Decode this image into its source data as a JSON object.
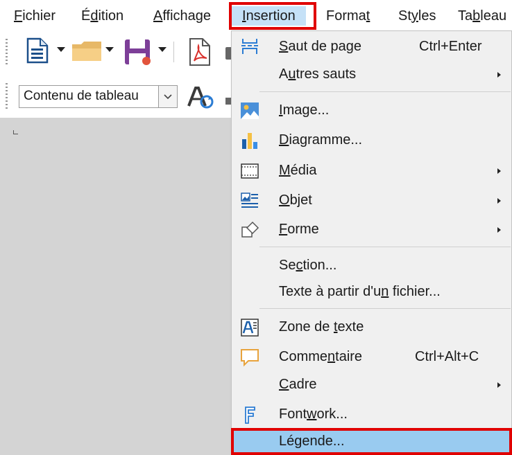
{
  "menubar": {
    "items": [
      {
        "key": "fichier",
        "pre": "",
        "ul": "F",
        "post": "ichier"
      },
      {
        "key": "edition",
        "pre": "É",
        "ul": "d",
        "post": "ition"
      },
      {
        "key": "affichage",
        "pre": "",
        "ul": "A",
        "post": "ffichage"
      },
      {
        "key": "insertion",
        "pre": "",
        "ul": "I",
        "post": "nsertion"
      },
      {
        "key": "format",
        "pre": "Forma",
        "ul": "t",
        "post": ""
      },
      {
        "key": "styles",
        "pre": "St",
        "ul": "y",
        "post": "les"
      },
      {
        "key": "tableau",
        "pre": "Ta",
        "ul": "b",
        "post": "leau"
      }
    ],
    "active": "Insertion"
  },
  "toolbar": {
    "paragraph_style": "Contenu de tableau"
  },
  "dropdown": {
    "items": [
      {
        "key": "saut-de-page",
        "pre": "",
        "ul": "S",
        "post": "aut de page",
        "shortcut": "Ctrl+Enter",
        "icon": "page-break-icon"
      },
      {
        "key": "autres-sauts",
        "pre": "A",
        "ul": "u",
        "post": "tres sauts",
        "submenu": true
      },
      {
        "key": "image",
        "pre": "",
        "ul": "I",
        "post": "mage...",
        "icon": "image-icon"
      },
      {
        "key": "diagramme",
        "pre": "",
        "ul": "D",
        "post": "iagramme...",
        "icon": "chart-icon"
      },
      {
        "key": "media",
        "pre": "",
        "ul": "M",
        "post": "édia",
        "submenu": true,
        "icon": "media-icon"
      },
      {
        "key": "objet",
        "pre": "",
        "ul": "O",
        "post": "bjet",
        "submenu": true,
        "icon": "object-icon"
      },
      {
        "key": "forme",
        "pre": "",
        "ul": "F",
        "post": "orme",
        "submenu": true,
        "icon": "shape-icon"
      },
      {
        "key": "section",
        "pre": "Se",
        "ul": "c",
        "post": "tion..."
      },
      {
        "key": "texte-fichier",
        "pre": "Texte à partir d'u",
        "ul": "n",
        "post": " fichier..."
      },
      {
        "key": "zone-de-texte",
        "pre": "Zone de ",
        "ul": "t",
        "post": "exte",
        "icon": "text-box-icon"
      },
      {
        "key": "commentaire",
        "pre": "Comme",
        "ul": "n",
        "post": "taire",
        "shortcut": "Ctrl+Alt+C",
        "icon": "comment-icon"
      },
      {
        "key": "cadre",
        "pre": "",
        "ul": "C",
        "post": "adre",
        "submenu": true
      },
      {
        "key": "fontwork",
        "pre": "Font",
        "ul": "w",
        "post": "ork...",
        "icon": "fontwork-icon"
      },
      {
        "key": "legende",
        "pre": "Lé",
        "ul": "g",
        "post": "ende...",
        "selected": true
      }
    ]
  },
  "colors": {
    "highlight_box": "#e00000",
    "selected_item": "#99cbf0",
    "menu_background": "#f0f0f0",
    "document_background": "#d4d4d4"
  }
}
